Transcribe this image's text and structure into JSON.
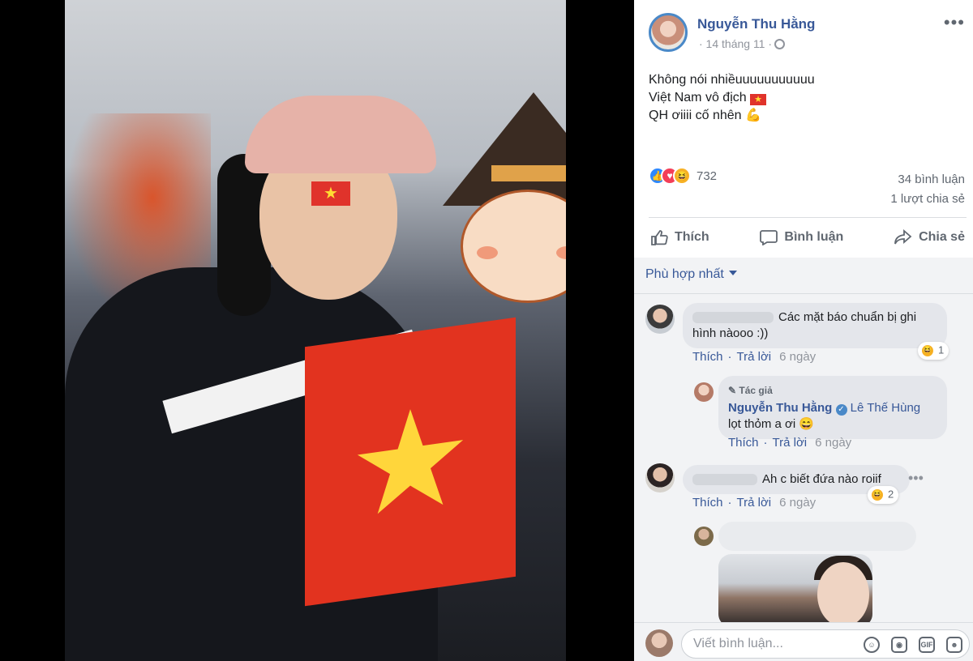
{
  "post": {
    "author": "Nguyễn Thu Hằng",
    "date": "· 14 tháng 11 ·",
    "body_lines": [
      "Không nói nhiềuuuuuuuuuuu",
      "Việt Nam vô địch",
      "QH ơiiii cố nhên"
    ],
    "reaction_count": "732",
    "comments_count": "34 bình luận",
    "shares_count": "1 lượt chia sẻ"
  },
  "actions": {
    "like": "Thích",
    "comment": "Bình luận",
    "share": "Chia sẻ"
  },
  "sort": {
    "label": "Phù hợp nhất"
  },
  "comments": [
    {
      "text": "Các mặt báo chuẩn bị ghi hình nàooo :))",
      "like": "Thích",
      "reply": "Trả lời",
      "time": "6 ngày",
      "reaction_count": "1"
    },
    {
      "badge": "Tác giả",
      "author": "Nguyễn Thu Hằng",
      "tagged": "Lê Thế Hùng",
      "text": "lọt thỏm a ơi",
      "like": "Thích",
      "reply": "Trả lời",
      "time": "6 ngày"
    },
    {
      "text": "Ah c biết đứa nào roiif",
      "like": "Thích",
      "reply": "Trả lời",
      "time": "6 ngày",
      "reaction_count": "2"
    }
  ],
  "composer": {
    "placeholder": "Viết bình luận...",
    "gif_label": "GIF"
  },
  "colors": {
    "link": "#385898",
    "panel_bg": "#f2f3f5",
    "flag_red": "#e0332b",
    "flag_star": "#ffdd33"
  }
}
